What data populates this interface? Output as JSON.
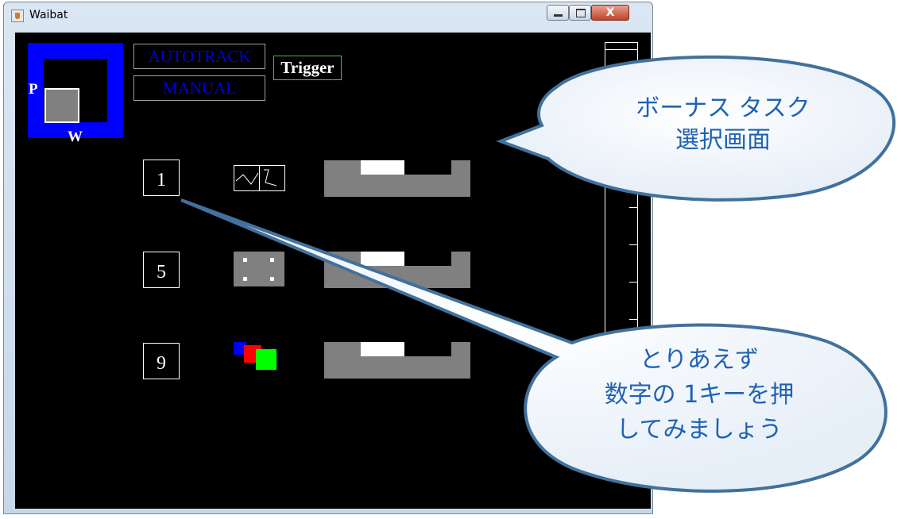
{
  "window": {
    "title": "Waibat",
    "close_label": "X"
  },
  "display": {
    "label_p": "P",
    "label_w": "W",
    "autotrack_label": "AUTOTRACK",
    "manual_label": "MANUAL",
    "trigger_label": "Trigger"
  },
  "tasks": [
    {
      "key": "1",
      "icon": "tracking-wave-icon"
    },
    {
      "key": "5",
      "icon": "monitoring-dots-icon"
    },
    {
      "key": "9",
      "icon": "rgb-squares-icon"
    }
  ],
  "callouts": {
    "bonus_line1": "ボーナス タスク",
    "bonus_line2": "選択画面",
    "instruction_line1": "とりあえず",
    "instruction_line2": "数字の 1キーを押",
    "instruction_line3": "してみましょう"
  },
  "colors": {
    "accent_blue": "#0000ff",
    "callout_text": "#1f62b4",
    "trigger_border": "#2ecc40"
  }
}
